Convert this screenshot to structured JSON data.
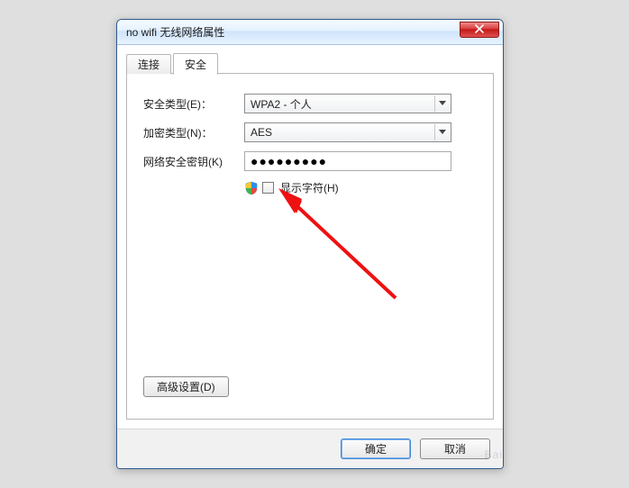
{
  "window": {
    "title": "no wifi 无线网络属性"
  },
  "tabs": {
    "connect": "连接",
    "security": "安全"
  },
  "form": {
    "security_type_label": "安全类型(E)：",
    "security_type_value": "WPA2 - 个人",
    "encryption_label": "加密类型(N)：",
    "encryption_value": "AES",
    "key_label": "网络安全密钥(K)",
    "key_masked": "●●●●●●●●●",
    "show_chars_label": "显示字符(H)"
  },
  "buttons": {
    "advanced": "高级设置(D)",
    "ok": "确定",
    "cancel": "取消"
  },
  "watermark": "Bai"
}
